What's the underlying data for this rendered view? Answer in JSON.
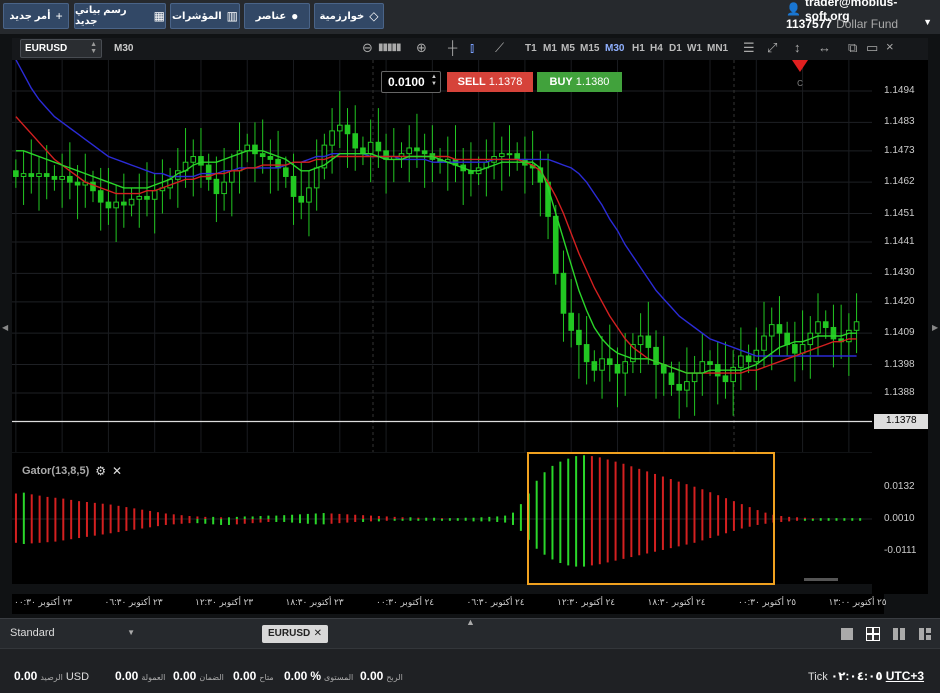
{
  "toolbar": {
    "buttons": [
      {
        "label": "أمر جديد",
        "icon": "plus-icon"
      },
      {
        "label": "رسم بياني جديد",
        "icon": "chart-icon"
      },
      {
        "label": "المؤشرات",
        "icon": "bar-chart-icon"
      },
      {
        "label": "عناصر",
        "icon": "shapes-icon"
      },
      {
        "label": "خوارزمية",
        "icon": "diamond-icon"
      }
    ]
  },
  "account": {
    "email": "trader@mobius-soft.org",
    "number": "1137577",
    "fund": "Dollar Fund"
  },
  "chart_toolbar": {
    "symbol": "EURUSD",
    "timeframe": "M30",
    "timeframes": [
      "T1",
      "M1",
      "M5",
      "M15",
      "M30",
      "H1",
      "H4",
      "D1",
      "W1",
      "MN1"
    ],
    "active_timeframe": "M30"
  },
  "trade": {
    "lot": "0.0100",
    "sell_label": "SELL",
    "sell_price": "1.1378",
    "buy_label": "BUY",
    "buy_price": "1.1380"
  },
  "marker_label": "C",
  "indicator": {
    "name": "Gator(13,8,5)"
  },
  "chart_data": [
    {
      "type": "candlestick",
      "symbol": "EURUSD",
      "timeframe": "M30",
      "y_ticks": [
        "1.1494",
        "1.1483",
        "1.1473",
        "1.1462",
        "1.1451",
        "1.1441",
        "1.1430",
        "1.1420",
        "1.1409",
        "1.1398",
        "1.1388"
      ],
      "current_price": "1.1378",
      "close": [
        1.1464,
        1.1465,
        1.1464,
        1.1465,
        1.1464,
        1.1463,
        1.1464,
        1.1462,
        1.1461,
        1.1462,
        1.1459,
        1.1455,
        1.1453,
        1.1455,
        1.1454,
        1.1456,
        1.1457,
        1.1456,
        1.1459,
        1.146,
        1.1463,
        1.1466,
        1.1469,
        1.1471,
        1.1468,
        1.1463,
        1.1458,
        1.1462,
        1.1466,
        1.1473,
        1.1475,
        1.1472,
        1.1471,
        1.147,
        1.1467,
        1.1464,
        1.1457,
        1.1455,
        1.146,
        1.1467,
        1.1475,
        1.148,
        1.1482,
        1.1479,
        1.1474,
        1.1472,
        1.1476,
        1.1473,
        1.147,
        1.1471,
        1.1472,
        1.1474,
        1.1473,
        1.1472,
        1.147,
        1.1469,
        1.147,
        1.1468,
        1.1466,
        1.1465,
        1.1467,
        1.1469,
        1.1471,
        1.1472,
        1.1472,
        1.147,
        1.1468,
        1.1467,
        1.1462,
        1.145,
        1.143,
        1.1416,
        1.141,
        1.1405,
        1.1399,
        1.1396,
        1.14,
        1.1398,
        1.1395,
        1.1399,
        1.1405,
        1.1408,
        1.1404,
        1.1398,
        1.1395,
        1.1391,
        1.1389,
        1.1392,
        1.1395,
        1.1399,
        1.1398,
        1.1394,
        1.1392,
        1.1397,
        1.1401,
        1.1399,
        1.1403,
        1.1408,
        1.1412,
        1.1409,
        1.1405,
        1.1402,
        1.1405,
        1.1409,
        1.1413,
        1.1411,
        1.1407,
        1.1406,
        1.141,
        1.1413
      ],
      "lines": [
        {
          "color": "#2b2bd6",
          "values": [
            1.1505,
            1.15,
            1.1495,
            1.1491,
            1.1488,
            1.1485,
            1.1483,
            1.1481,
            1.1479,
            1.1477,
            1.1475,
            1.1473,
            1.1471,
            1.147,
            1.1469,
            1.1468,
            1.1467,
            1.1466,
            1.1465,
            1.1465,
            1.1464,
            1.1464,
            1.1464,
            1.1464,
            1.1465,
            1.1465,
            1.1465,
            1.1466,
            1.1466,
            1.1467,
            1.1467,
            1.1467,
            1.1467,
            1.1467,
            1.1467,
            1.1468,
            1.1469,
            1.1469,
            1.147,
            1.1471,
            1.1471,
            1.1472,
            1.1472,
            1.1472,
            1.1472,
            1.1472,
            1.1471,
            1.1471,
            1.1471,
            1.1471,
            1.147,
            1.147,
            1.147,
            1.147,
            1.1469,
            1.1469,
            1.1469,
            1.1469,
            1.1469,
            1.1469,
            1.1469,
            1.1469,
            1.147,
            1.147,
            1.147,
            1.147,
            1.147,
            1.147,
            1.147,
            1.147,
            1.1469,
            1.1468,
            1.1467,
            1.1465,
            1.1462,
            1.1458,
            1.1454,
            1.1449,
            1.1445,
            1.144,
            1.1436,
            1.1432,
            1.1428,
            1.1424,
            1.1421,
            1.1418,
            1.1415,
            1.1413,
            1.1411,
            1.1409,
            1.1407,
            1.1406,
            1.1405,
            1.1404,
            1.1403,
            1.1402,
            1.1401,
            1.1401,
            1.1401,
            1.1401,
            1.1401,
            1.1401,
            1.1401,
            1.1401,
            1.1401,
            1.1401,
            1.1401,
            1.1401,
            1.1401,
            1.1401
          ]
        },
        {
          "color": "#d42020",
          "values": [
            1.1485,
            1.1482,
            1.1479,
            1.1476,
            1.1473,
            1.147,
            1.1468,
            1.1466,
            1.1464,
            1.1462,
            1.1461,
            1.146,
            1.1459,
            1.1458,
            1.1458,
            1.1458,
            1.1458,
            1.1459,
            1.1459,
            1.146,
            1.1461,
            1.1462,
            1.1463,
            1.1463,
            1.1464,
            1.1464,
            1.1465,
            1.1465,
            1.1466,
            1.1466,
            1.1467,
            1.1467,
            1.1468,
            1.1468,
            1.1468,
            1.1468,
            1.1469,
            1.1469,
            1.1469,
            1.147,
            1.147,
            1.1471,
            1.1471,
            1.1471,
            1.1471,
            1.1471,
            1.1471,
            1.1471,
            1.1471,
            1.1471,
            1.1471,
            1.1471,
            1.1471,
            1.1471,
            1.1471,
            1.1471,
            1.1471,
            1.147,
            1.147,
            1.147,
            1.147,
            1.147,
            1.147,
            1.147,
            1.147,
            1.147,
            1.1469,
            1.1468,
            1.1466,
            1.1462,
            1.1457,
            1.1451,
            1.1444,
            1.1437,
            1.1431,
            1.1425,
            1.142,
            1.1415,
            1.1411,
            1.1407,
            1.1404,
            1.1402,
            1.14,
            1.1399,
            1.1398,
            1.1397,
            1.1396,
            1.1395,
            1.1395,
            1.1395,
            1.1395,
            1.1395,
            1.1395,
            1.1395,
            1.1395,
            1.1396,
            1.1396,
            1.1397,
            1.1398,
            1.1399,
            1.14,
            1.1401,
            1.1402,
            1.1403,
            1.1404,
            1.1405,
            1.1406,
            1.1406,
            1.1407,
            1.1407
          ]
        },
        {
          "color": "#2ad62a",
          "values": [
            1.1473,
            1.1473,
            1.1472,
            1.1471,
            1.147,
            1.1469,
            1.1468,
            1.1467,
            1.1466,
            1.1465,
            1.1464,
            1.1463,
            1.1462,
            1.1461,
            1.146,
            1.146,
            1.146,
            1.146,
            1.1461,
            1.1462,
            1.1463,
            1.1465,
            1.1466,
            1.1468,
            1.1469,
            1.1469,
            1.1469,
            1.147,
            1.1471,
            1.1472,
            1.1473,
            1.1473,
            1.1473,
            1.1472,
            1.1471,
            1.147,
            1.1468,
            1.1466,
            1.1466,
            1.1467,
            1.1468,
            1.147,
            1.1472,
            1.1472,
            1.1472,
            1.1472,
            1.1472,
            1.1471,
            1.147,
            1.147,
            1.147,
            1.1471,
            1.1471,
            1.1471,
            1.1471,
            1.147,
            1.1469,
            1.1468,
            1.1467,
            1.1466,
            1.1466,
            1.1467,
            1.1468,
            1.1469,
            1.1469,
            1.1469,
            1.1469,
            1.1469,
            1.1467,
            1.146,
            1.1451,
            1.1442,
            1.1433,
            1.1424,
            1.1417,
            1.1411,
            1.1407,
            1.1404,
            1.1402,
            1.1401,
            1.14,
            1.14,
            1.14,
            1.1399,
            1.1398,
            1.1397,
            1.1396,
            1.1395,
            1.1395,
            1.1395,
            1.1396,
            1.1396,
            1.1396,
            1.1396,
            1.1396,
            1.1397,
            1.1398,
            1.14,
            1.1402,
            1.1404,
            1.1405,
            1.1406,
            1.1406,
            1.1407,
            1.1408,
            1.1408,
            1.1408,
            1.1408,
            1.1409,
            1.1409
          ]
        }
      ]
    },
    {
      "type": "bar",
      "name": "Gator(13,8,5)",
      "y_ticks": [
        "0.0132",
        "0.0010",
        "-0.0111"
      ],
      "upper": [
        0.006,
        0.0062,
        0.0058,
        0.0055,
        0.0052,
        0.005,
        0.0048,
        0.0045,
        0.0042,
        0.004,
        0.0038,
        0.0036,
        0.0034,
        0.0031,
        0.0028,
        0.0025,
        0.0022,
        0.0019,
        0.0016,
        0.0013,
        0.0011,
        0.0009,
        0.0007,
        0.0006,
        0.0005,
        0.0005,
        0.0004,
        0.0004,
        0.0005,
        0.0006,
        0.0006,
        0.0007,
        0.0008,
        0.0008,
        0.0009,
        0.001,
        0.0011,
        0.0012,
        0.0013,
        0.0014,
        0.0013,
        0.0012,
        0.0011,
        0.001,
        0.0009,
        0.0008,
        0.0007,
        0.0006,
        0.0005,
        0.0004,
        0.0004,
        0.0003,
        0.0003,
        0.0003,
        0.0002,
        0.0002,
        0.0002,
        0.0003,
        0.0003,
        0.0004,
        0.0005,
        0.0006,
        0.0008,
        0.0015,
        0.0035,
        0.006,
        0.009,
        0.011,
        0.0125,
        0.0135,
        0.0142,
        0.0148,
        0.015,
        0.0148,
        0.0145,
        0.014,
        0.0135,
        0.013,
        0.0124,
        0.0118,
        0.0112,
        0.0106,
        0.01,
        0.0094,
        0.0088,
        0.0082,
        0.0076,
        0.007,
        0.0063,
        0.0056,
        0.0049,
        0.0042,
        0.0035,
        0.0028,
        0.0021,
        0.0015,
        0.001,
        0.0007,
        0.0005,
        0.0004,
        0.0003,
        0.0002,
        0.0002,
        0.0002,
        0.0002,
        0.0002,
        0.0002,
        0.0002
      ],
      "lower": [
        0.004,
        0.0042,
        0.0041,
        0.004,
        0.0039,
        0.0038,
        0.0036,
        0.0034,
        0.0032,
        0.003,
        0.0028,
        0.0026,
        0.0024,
        0.0022,
        0.002,
        0.0018,
        0.0016,
        0.0014,
        0.0012,
        0.001,
        0.0009,
        0.0008,
        0.0007,
        0.0007,
        0.0008,
        0.0009,
        0.001,
        0.001,
        0.0009,
        0.0008,
        0.0007,
        0.0006,
        0.0005,
        0.0005,
        0.0005,
        0.0006,
        0.0007,
        0.0008,
        0.0009,
        0.0009,
        0.0008,
        0.0007,
        0.0006,
        0.0005,
        0.0005,
        0.0004,
        0.0004,
        0.0003,
        0.0003,
        0.0003,
        0.0003,
        0.0003,
        0.0003,
        0.0003,
        0.0003,
        0.0003,
        0.0003,
        0.0003,
        0.0004,
        0.0004,
        0.0004,
        0.0005,
        0.0006,
        0.001,
        0.002,
        0.0035,
        0.005,
        0.006,
        0.0068,
        0.0074,
        0.0078,
        0.008,
        0.008,
        0.0078,
        0.0076,
        0.0073,
        0.007,
        0.0067,
        0.0064,
        0.0061,
        0.0058,
        0.0055,
        0.0052,
        0.0049,
        0.0046,
        0.0043,
        0.004,
        0.0036,
        0.0032,
        0.0028,
        0.0024,
        0.002,
        0.0016,
        0.0013,
        0.001,
        0.0008,
        0.0006,
        0.0005,
        0.0004,
        0.0003,
        0.0003,
        0.0003,
        0.0003,
        0.0003,
        0.0003,
        0.0003,
        0.0003,
        0.0003
      ]
    }
  ],
  "time_labels": [
    "٢٣ أكتوبر ٠٠:٣٠",
    "٢٣ أكتوبر ٠٦:٣٠",
    "٢٣ أكتوبر ١٢:٣٠",
    "٢٣ أكتوبر ١٨:٣٠",
    "٢٤ أكتوبر ٠٠:٣٠",
    "٢٤ أكتوبر ٠٦:٣٠",
    "٢٤ أكتوبر ١٢:٣٠",
    "٢٤ أكتوبر ١٨:٣٠",
    "٢٥ أكتوبر ٠٠:٣٠",
    "٢٥ أكتوبر ١٣:٠٠"
  ],
  "bottom": {
    "template": "Standard",
    "tab": "EURUSD",
    "status": {
      "balance_label": "الرصيد",
      "balance": "0.00",
      "currency": "USD",
      "commission_label": "العمولة",
      "commission": "0.00",
      "margin_label": "الضمان",
      "margin": "0.00",
      "free_label": "متاح",
      "free": "0.00",
      "level_label": "المستوى",
      "level": "0.00",
      "level_unit": "%",
      "profit_label": "الربح",
      "profit": "0.00",
      "tick_label": "Tick",
      "time": "٠٢:٠٤:٠٥",
      "tz": "UTC+3"
    }
  },
  "colors": {
    "bull": "#2ad62a",
    "bear": "#d42020",
    "highlight": "#f0a11f",
    "sell": "#d6433a",
    "buy": "#41a23c"
  }
}
